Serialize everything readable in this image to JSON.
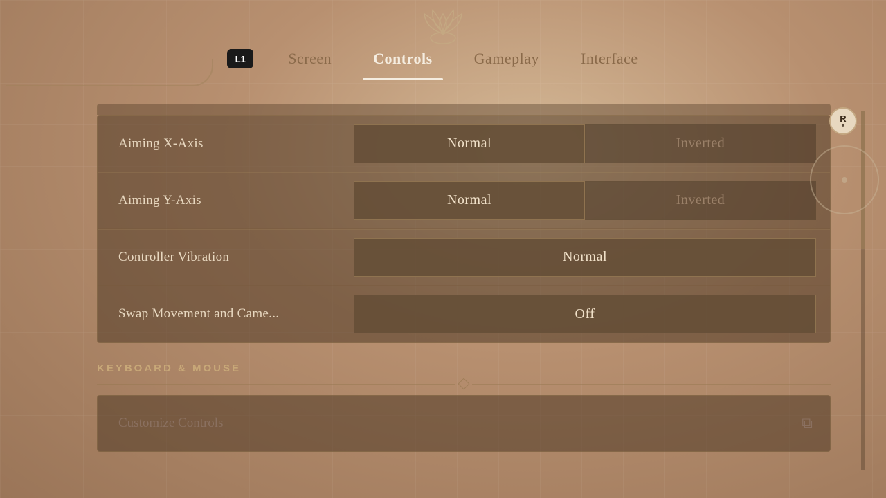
{
  "nav": {
    "l1_label": "L1",
    "tabs": [
      {
        "id": "screen",
        "label": "Screen",
        "active": false
      },
      {
        "id": "controls",
        "label": "Controls",
        "active": true
      },
      {
        "id": "gameplay",
        "label": "Gameplay",
        "active": false
      },
      {
        "id": "interface",
        "label": "Interface",
        "active": false
      }
    ]
  },
  "settings": {
    "rows": [
      {
        "id": "aiming-x",
        "label": "Aiming X-Axis",
        "type": "toggle",
        "options": [
          "Normal",
          "Inverted"
        ],
        "selected": 0
      },
      {
        "id": "aiming-y",
        "label": "Aiming Y-Axis",
        "type": "toggle",
        "options": [
          "Normal",
          "Inverted"
        ],
        "selected": 0
      },
      {
        "id": "controller-vibration",
        "label": "Controller Vibration",
        "type": "single",
        "value": "Normal"
      },
      {
        "id": "swap-movement",
        "label": "Swap Movement and Came...",
        "type": "single",
        "value": "Off"
      }
    ]
  },
  "keyboard_section": {
    "header": "KEYBOARD & MOUSE",
    "customize_label": "Customize Controls",
    "customize_icon": "⧉"
  },
  "scrollbar": {
    "r_label": "R"
  }
}
